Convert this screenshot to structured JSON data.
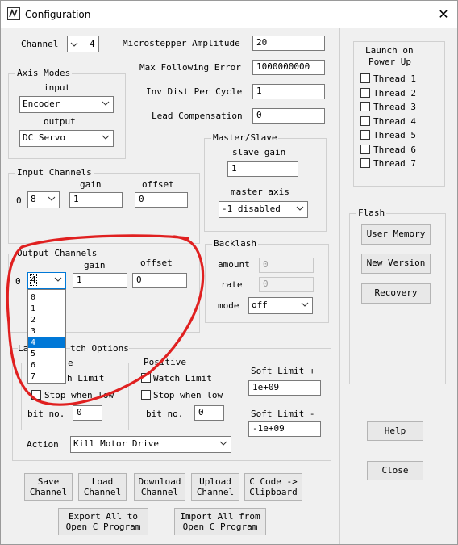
{
  "window": {
    "title": "Configuration",
    "close_glyph": "✕"
  },
  "axis": {
    "channel_label": "Channel",
    "channel_value": "4",
    "modes_title": "Axis Modes",
    "input_label": "input",
    "input_value": "Encoder",
    "output_label": "output",
    "output_value": "DC Servo"
  },
  "params": {
    "amplitude_label": "Microstepper Amplitude",
    "amplitude_value": "20",
    "following_label": "Max Following Error",
    "following_value": "1000000000",
    "invdist_label": "Inv Dist Per Cycle",
    "invdist_value": "1",
    "lead_label": "Lead Compensation",
    "lead_value": "0"
  },
  "master_slave": {
    "title": "Master/Slave",
    "slave_gain_label": "slave gain",
    "slave_gain_value": "1",
    "master_axis_label": "master axis",
    "master_axis_value": "-1 disabled"
  },
  "input_channels": {
    "title": "Input Channels",
    "gain_label": "gain",
    "offset_label": "offset",
    "index": "0",
    "channel_value": "8",
    "gain_value": "1",
    "offset_value": "0"
  },
  "output_channels": {
    "title": "Output Channels",
    "gain_label": "gain",
    "offset_label": "offset",
    "index": "0",
    "channel_value": "4",
    "gain_value": "1",
    "offset_value": "0",
    "dropdown_options": [
      "0",
      "1",
      "2",
      "3",
      "4",
      "5",
      "6",
      "7"
    ]
  },
  "backlash": {
    "title": "Backlash",
    "amount_label": "amount",
    "amount_value": "0",
    "rate_label": "rate",
    "rate_value": "0",
    "mode_label": "mode",
    "mode_value": "off"
  },
  "limits": {
    "title_visible": "La",
    "title_visible_end": "tch Options",
    "negative_title_end": "e",
    "positive_title": "Positive",
    "neg_watch_end": "h Limit",
    "neg_stop": "Stop when low",
    "neg_bit_label": "bit no.",
    "neg_bit_value": "0",
    "pos_watch": "Watch Limit",
    "pos_stop": "Stop when low",
    "pos_bit_label": "bit no.",
    "pos_bit_value": "0",
    "soft_pos_label": "Soft Limit +",
    "soft_pos_value": "1e+09",
    "soft_neg_label": "Soft Limit -",
    "soft_neg_value": "-1e+09",
    "action_label": "Action",
    "action_value": "Kill Motor Drive"
  },
  "launch": {
    "title_line1": "Launch on",
    "title_line2": "Power Up",
    "threads": [
      "Thread 1",
      "Thread 2",
      "Thread 3",
      "Thread 4",
      "Thread 5",
      "Thread 6",
      "Thread 7"
    ]
  },
  "flash": {
    "title": "Flash",
    "user_memory": "User Memory",
    "new_version": "New Version",
    "recovery": "Recovery"
  },
  "buttons": {
    "help": "Help",
    "close": "Close",
    "save_l1": "Save",
    "save_l2": "Channel",
    "load_l1": "Load",
    "load_l2": "Channel",
    "download_l1": "Download",
    "download_l2": "Channel",
    "upload_l1": "Upload",
    "upload_l2": "Channel",
    "ccode_l1": "C Code ->",
    "ccode_l2": "Clipboard",
    "export_l1": "Export All to",
    "export_l2": "Open C Program",
    "import_l1": "Import All from",
    "import_l2": "Open C Program"
  },
  "colors": {
    "annotation": "#e02020",
    "selection": "#0078d7"
  },
  "icons": {
    "app": "app-icon",
    "chevron": "chevron-down-icon",
    "close": "close-icon"
  }
}
